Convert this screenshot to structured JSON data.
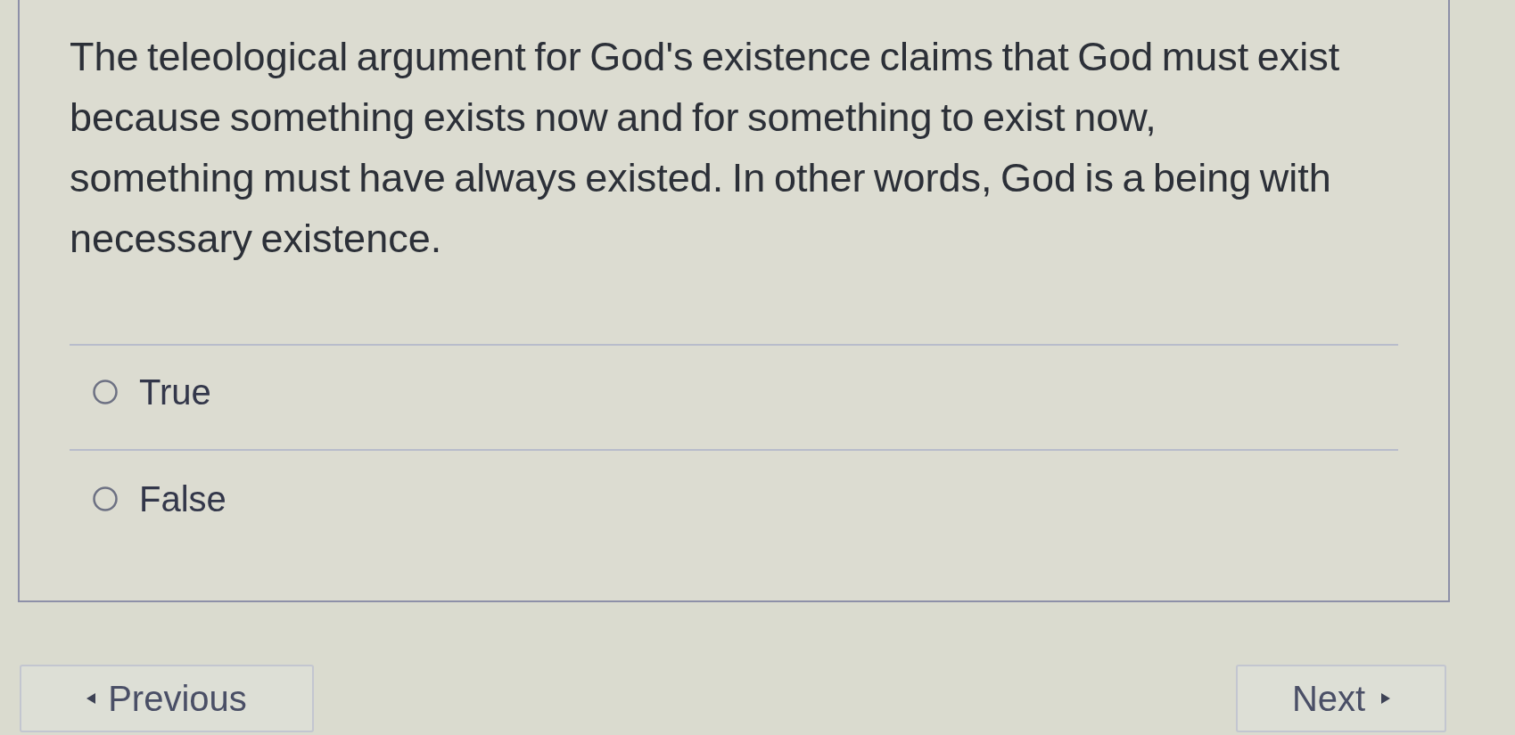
{
  "question": {
    "text": "The teleological argument for God's existence claims that God must exist because something exists now and for something to exist now, something must have always existed. In other words, God is a being with necessary existence."
  },
  "options": [
    {
      "label": "True",
      "selected": false
    },
    {
      "label": "False",
      "selected": false
    }
  ],
  "navigation": {
    "previous": {
      "label": "Previous"
    },
    "next": {
      "label": "Next"
    }
  }
}
